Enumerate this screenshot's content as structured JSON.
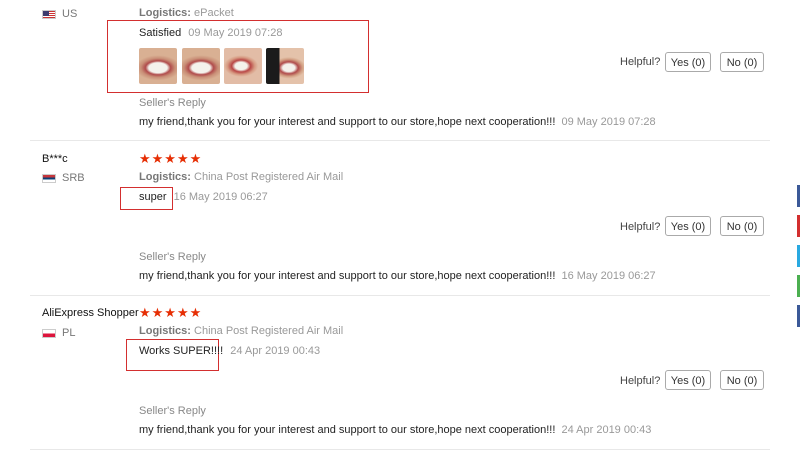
{
  "reviews": [
    {
      "username": "",
      "country": "US",
      "stars": "",
      "logistics_label": "Logistics:",
      "logistics_value": "ePacket",
      "text": "Satisfied",
      "date": "09 May 2019 07:28",
      "photos": [
        "photo-1",
        "photo-2",
        "photo-3",
        "photo-4"
      ],
      "helpful_label": "Helpful?",
      "yes_label": "Yes (0)",
      "no_label": "No (0)",
      "seller_reply_title": "Seller's Reply",
      "reply_text": "my friend,thank you for your interest and support to our store,hope next cooperation!!!",
      "reply_date": "09 May 2019 07:28"
    },
    {
      "username": "B***c",
      "country": "SRB",
      "stars": "★★★★★",
      "logistics_label": "Logistics:",
      "logistics_value": "China Post Registered Air Mail",
      "text": "super",
      "date": "16 May 2019 06:27",
      "helpful_label": "Helpful?",
      "yes_label": "Yes (0)",
      "no_label": "No (0)",
      "seller_reply_title": "Seller's Reply",
      "reply_text": "my friend,thank you for your interest and support to our store,hope next cooperation!!!",
      "reply_date": "16 May 2019 06:27"
    },
    {
      "username": "AliExpress Shopper",
      "country": "PL",
      "stars": "★★★★★",
      "logistics_label": "Logistics:",
      "logistics_value": "China Post Registered Air Mail",
      "text": "Works SUPER!!!!",
      "date": "24 Apr 2019 00:43",
      "helpful_label": "Helpful?",
      "yes_label": "Yes (0)",
      "no_label": "No (0)",
      "seller_reply_title": "Seller's Reply",
      "reply_text": "my friend,thank you for your interest and support to our store,hope next cooperation!!!",
      "reply_date": "24 Apr 2019 00:43"
    }
  ],
  "colors": {
    "stars": "#e62e04",
    "highlight_box": "#d32f2f"
  }
}
